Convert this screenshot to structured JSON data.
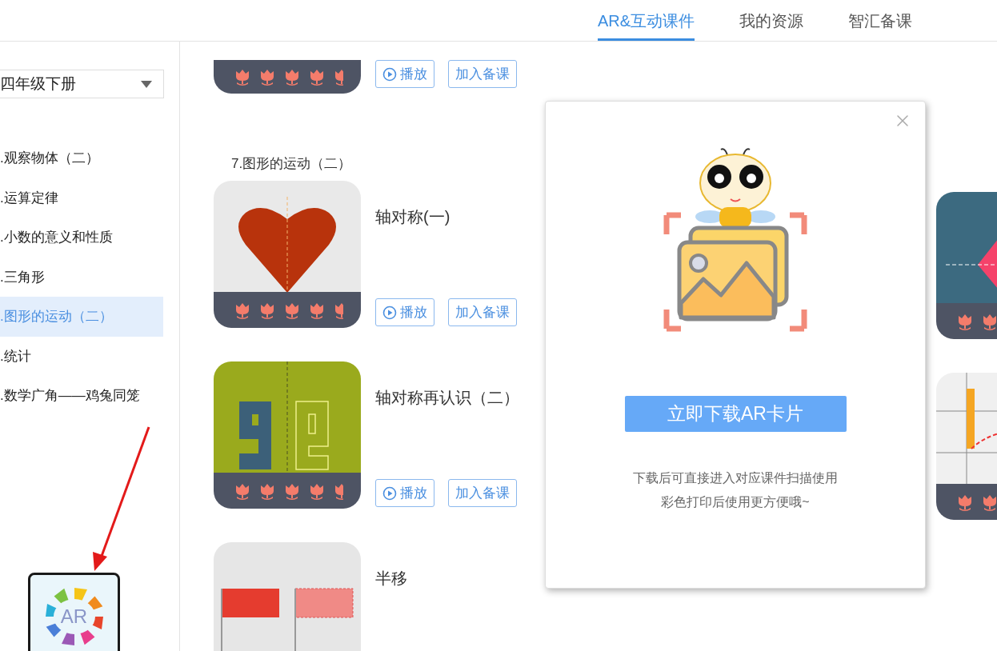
{
  "tabs": [
    {
      "label": "AR&互动课件",
      "selected": true
    },
    {
      "label": "我的资源",
      "selected": false
    },
    {
      "label": "智汇备课",
      "selected": false
    }
  ],
  "grade_select": {
    "value": "四年级下册"
  },
  "sidebar": {
    "items": [
      {
        "label": ".观察物体（二）",
        "selected": false
      },
      {
        "label": ".运算定律",
        "selected": false
      },
      {
        "label": ".小数的意义和性质",
        "selected": false
      },
      {
        "label": ".三角形",
        "selected": false
      },
      {
        "label": ".图形的运动（二）",
        "selected": true
      },
      {
        "label": ".统计",
        "selected": false
      },
      {
        "label": ".数学广角——鸡兔同笼",
        "selected": false
      }
    ]
  },
  "ar_icon": {
    "label": "AR"
  },
  "top_course": {
    "buttons": [
      "播放",
      "加入备课"
    ]
  },
  "section": {
    "title": "7.图形的运动（二）"
  },
  "courses": [
    {
      "kind": "heart",
      "title": "轴对称(一)",
      "buttons": [
        "播放",
        "加入备课"
      ]
    },
    {
      "kind": "letters",
      "title": "轴对称再认识（二）",
      "buttons": [
        "播放",
        "加入备课"
      ]
    },
    {
      "kind": "flags",
      "title": "半移"
    }
  ],
  "side_courses": [
    {
      "kind": "diamond"
    },
    {
      "kind": "pencil"
    }
  ],
  "modal": {
    "button": "立即下载AR卡片",
    "lines": [
      "下载后可直接进入对应课件扫描使用",
      "彩色打印后使用更方便哦~"
    ]
  }
}
